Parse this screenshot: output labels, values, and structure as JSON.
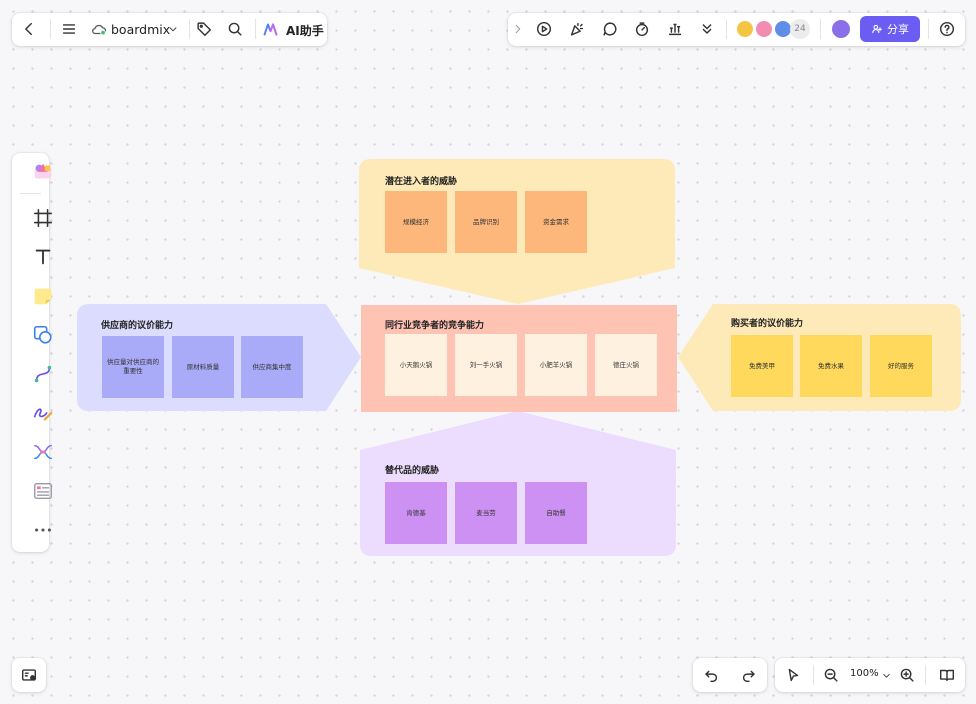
{
  "toolbar": {
    "brand": "boardmix",
    "ai_label": "AI助手"
  },
  "collab": {
    "avatar_colors": [
      "#f4c542",
      "#f28cb1",
      "#5f8de8"
    ],
    "count": "24",
    "share_label": "分享"
  },
  "board": {
    "top": {
      "title": "潜在进入者的威胁",
      "notes": [
        "规模经济",
        "品牌识别",
        "资金需求"
      ],
      "color": "#feeab8"
    },
    "center": {
      "title": "同行业竞争者的竞争能力",
      "notes": [
        "小天鹅火锅",
        "刘一手火锅",
        "小肥羊火锅",
        "德庄火锅"
      ],
      "color": "#ffc3b4"
    },
    "left": {
      "title": "供应商的议价能力",
      "notes": [
        "供应量对供应商的重要性",
        "原材料质量",
        "供应商集中度"
      ],
      "color": "#dcdcfe"
    },
    "right": {
      "title": "购买者的议价能力",
      "notes": [
        "免费美甲",
        "免费水果",
        "好的服务"
      ],
      "color": "#feeab8"
    },
    "bottom": {
      "title": "替代品的威胁",
      "notes": [
        "肯德基",
        "麦当劳",
        "自助餐"
      ],
      "color": "#ecdcfd"
    }
  },
  "zoom": {
    "level": "100%"
  },
  "icons": {
    "back": "chevron-left-icon",
    "menu": "hamburger-menu-icon",
    "cloud": "cloud-sync-icon",
    "tag": "tag-icon",
    "search": "search-icon",
    "help": "help-circle-icon"
  }
}
